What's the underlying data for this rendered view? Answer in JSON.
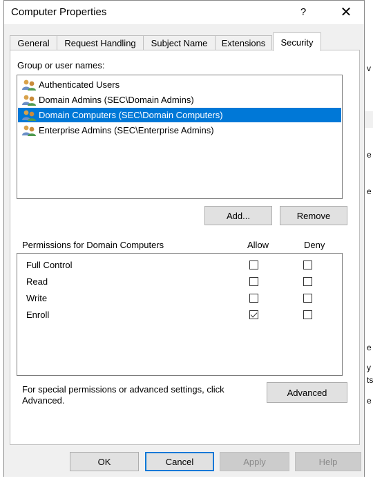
{
  "window": {
    "title": "Computer Properties",
    "help_label": "?",
    "close_label": "✕"
  },
  "tabs": [
    {
      "label": "General"
    },
    {
      "label": "Request Handling"
    },
    {
      "label": "Subject Name"
    },
    {
      "label": "Extensions"
    },
    {
      "label": "Security",
      "active": true
    }
  ],
  "security": {
    "group_label": "Group or user names:",
    "users": [
      {
        "label": "Authenticated Users"
      },
      {
        "label": "Domain Admins (SEC\\Domain Admins)"
      },
      {
        "label": "Domain Computers (SEC\\Domain Computers)",
        "selected": true
      },
      {
        "label": "Enterprise Admins (SEC\\Enterprise Admins)"
      }
    ],
    "add_label": "Add...",
    "remove_label": "Remove",
    "permissions_label": "Permissions for Domain Computers",
    "allow_header": "Allow",
    "deny_header": "Deny",
    "permissions": [
      {
        "label": "Full Control",
        "allow": false,
        "deny": false
      },
      {
        "label": "Read",
        "allow": false,
        "deny": false
      },
      {
        "label": "Write",
        "allow": false,
        "deny": false
      },
      {
        "label": "Enroll",
        "allow": true,
        "deny": false
      }
    ],
    "special_text_1": "For special permissions or advanced settings, click",
    "special_text_2": "Advanced.",
    "advanced_label": "Advanced"
  },
  "footer": {
    "ok_label": "OK",
    "cancel_label": "Cancel",
    "apply_label": "Apply",
    "help_label": "Help"
  },
  "background_fragments": [
    "v",
    "e",
    "e",
    "e",
    "y",
    "ts",
    "e"
  ]
}
